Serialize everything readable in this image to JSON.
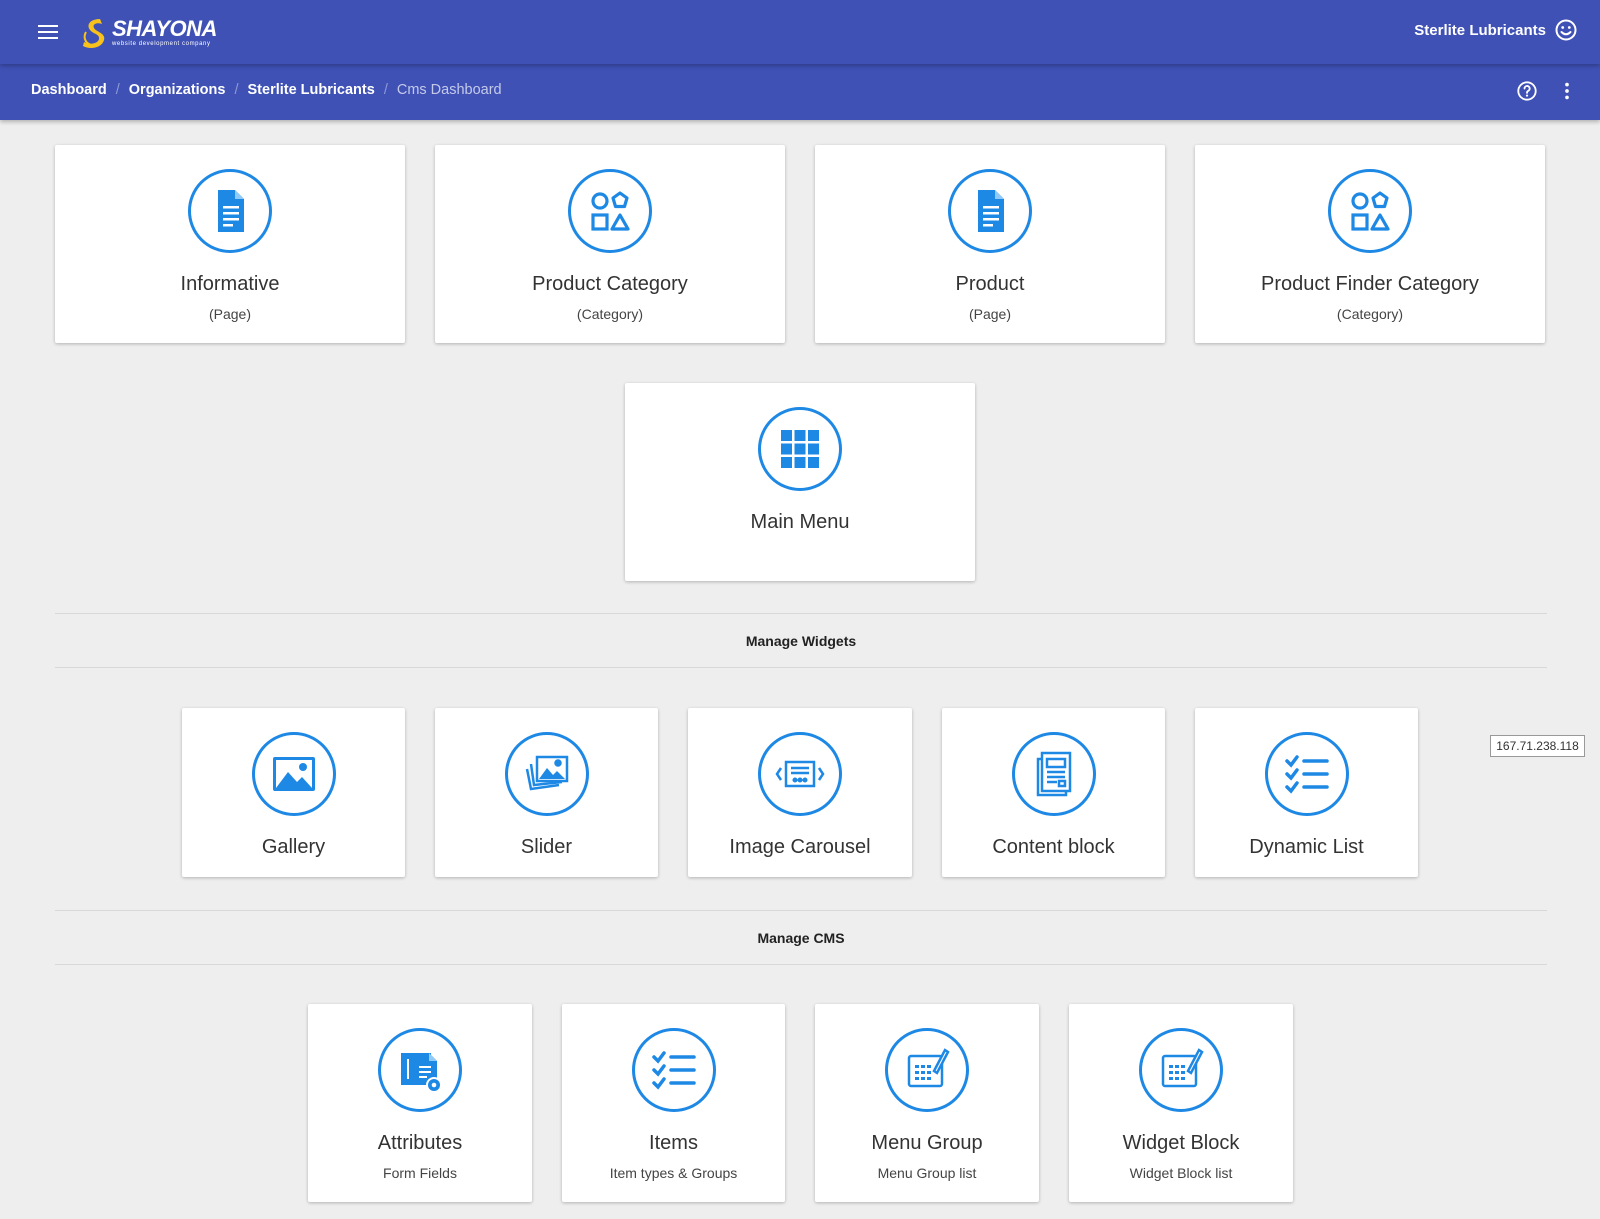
{
  "header": {
    "brand_name": "SHAYONA",
    "brand_tagline": "website development company",
    "user_name": "Sterlite Lubricants"
  },
  "breadcrumb": [
    "Dashboard",
    "Organizations",
    "Sterlite Lubricants",
    "Cms Dashboard"
  ],
  "accent_color": "#1e88e5",
  "header_color": "#3f51b5",
  "top_cards": [
    {
      "title": "Informative",
      "subtitle": "(Page)",
      "icon": "document-icon"
    },
    {
      "title": "Product Category",
      "subtitle": "(Category)",
      "icon": "shapes-icon"
    },
    {
      "title": "Product",
      "subtitle": "(Page)",
      "icon": "document-icon"
    },
    {
      "title": "Product Finder Category",
      "subtitle": "(Category)",
      "icon": "shapes-icon"
    },
    {
      "title": "Main Menu",
      "subtitle": "",
      "icon": "grid-icon"
    }
  ],
  "sections": {
    "widgets_title": "Manage Widgets",
    "cms_title": "Manage CMS"
  },
  "widget_cards": [
    {
      "title": "Gallery",
      "icon": "image-icon"
    },
    {
      "title": "Slider",
      "icon": "photo-stack-icon"
    },
    {
      "title": "Image Carousel",
      "icon": "carousel-icon"
    },
    {
      "title": "Content block",
      "icon": "newspaper-icon"
    },
    {
      "title": "Dynamic List",
      "icon": "checklist-icon"
    }
  ],
  "cms_cards": [
    {
      "title": "Attributes",
      "subtitle": "Form Fields",
      "icon": "form-settings-icon"
    },
    {
      "title": "Items",
      "subtitle": "Item types & Groups",
      "icon": "checklist-icon"
    },
    {
      "title": "Menu Group",
      "subtitle": "Menu Group list",
      "icon": "edit-table-icon"
    },
    {
      "title": "Widget Block",
      "subtitle": "Widget Block list",
      "icon": "edit-table-icon"
    }
  ],
  "ip_address": "167.71.238.118"
}
